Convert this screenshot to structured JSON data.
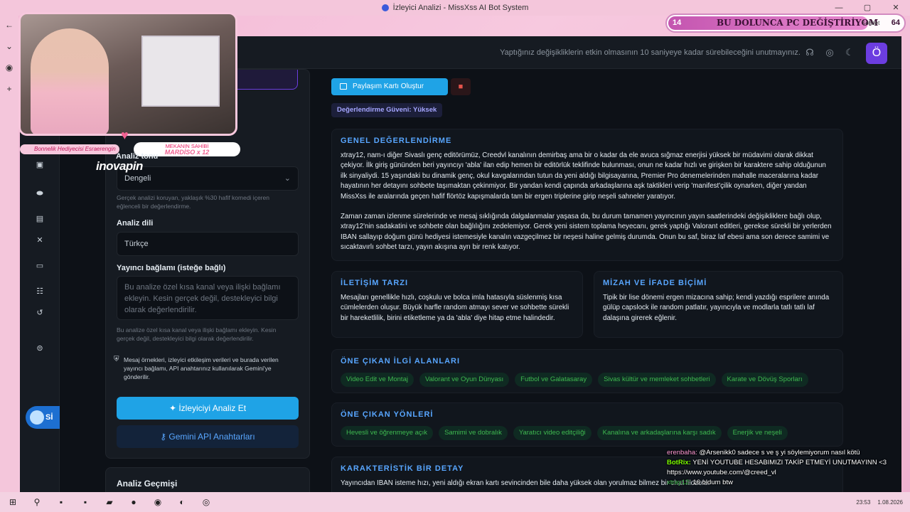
{
  "window": {
    "title": "İzleyici Analizi - MissXss AI Bot System"
  },
  "header": {
    "note": "Yaptığınız değişikliklerin etkin olmasının 10 saniyeye kadar sürebileceğini unutmayınız.",
    "avatar_letter": "Ö"
  },
  "stream_overlay": {
    "goal_current": "14",
    "goal_text": "BU DOLUNCA PC DEĞİŞTİRİYOM",
    "goal_sub": "Sohbet",
    "goal_target": "64",
    "caption_left": "Bonnelik Hediyecisi Esraerengin",
    "caption_right_title": "MEKANIN SAHİBİ",
    "caption_right_name": "MARDİSO x 12",
    "logo": "inovapin"
  },
  "left_panel": {
    "analysis_tone_label": "Analiz tonu",
    "tone_value": "Dengeli",
    "tone_help": "Gerçek analizi koruyan, yaklaşık %30 hafif komedi içeren eğlenceli bir değerlendirme.",
    "language_label": "Analiz dili",
    "language_value": "Türkçe",
    "context_label": "Yayıncı bağlamı (isteğe bağlı)",
    "context_placeholder": "Bu analize özel kısa kanal veya ilişki bağlamı ekleyin. Kesin gerçek değil, destekleyici bilgi olarak değerlendirilir.",
    "context_help": "Bu analize özel kısa kanal veya ilişki bağlamı ekleyin. Kesin gerçek değil, destekleyici bilgi olarak değerlendirilir.",
    "privacy_notice": "Mesaj örnekleri, izleyici etkileşim verileri ve burada verilen yayıncı bağlamı, API anahtarınız kullanılarak Gemini'ye gönderilir.",
    "analyze_button": "İzleyiciyi Analiz Et",
    "keys_button": "Gemini API Anahtarları",
    "history_title": "Analiz Geçmişi"
  },
  "sidebar": {
    "pill_label": "Sİ"
  },
  "content": {
    "share_button": "Paylaşım Kartı Oluştur",
    "confidence_badge": "Değerlendirme Güveni: Yüksek",
    "general": {
      "title": "GENEL DEĞERLENDİRME",
      "p1": "xtray12, nam-ı diğer Sivaslı genç editörümüz, Creedvl kanalının demirbaş ama bir o kadar da ele avuca sığmaz enerjisi yüksek bir müdavimi olarak dikkat çekiyor. İlk giriş gününden beri yayıncıyı 'abla' ilan edip hemen bir editörlük teklifinde bulunması, onun ne kadar hızlı ve girişken bir karaktere sahip olduğunun ilk sinyaliydi. 15 yaşındaki bu dinamik genç, okul kavgalarından tutun da yeni aldığı bilgisayarına, Premier Pro denemelerinden mahalle maceralarına kadar hayatının her detayını sohbete taşımaktan çekinmiyor. Bir yandan kendi çapında arkadaşlarına aşk taktikleri verip 'manifest'çilik oynarken, diğer yandan MissXss ile aralarında geçen hafif flörtöz kapışmalarda tam bir ergen triplerine girip neşeli sahneler yaratıyor.",
      "p2": "Zaman zaman izlenme sürelerinde ve mesaj sıklığında dalgalanmalar yaşasa da, bu durum tamamen yayıncının yayın saatlerindeki değişikliklere bağlı olup, xtray12'nin sadakatini ve sohbete olan bağlılığını zedelemiyor. Gerek yeni sistem toplama heyecanı, gerek yaptığı Valorant editleri, gerekse sürekli bir yerlerden IBAN sallayıp doğum günü hediyesi istemesiyle kanalın vazgeçilmez bir neşesi haline gelmiş durumda. Onun bu saf, biraz laf ebesi ama son derece samimi ve sıcaktavırlı sohbet tarzı, yayın akışına ayrı bir renk katıyor."
    },
    "communication": {
      "title": "İLETİŞİM TARZI",
      "text": "Mesajları genellikle hızlı, coşkulu ve bolca imla hatasıyla süslenmiş kısa cümlelerden oluşur. Büyük harfle random atmayı sever ve sohbette sürekli bir hareketlilik, birini etiketleme ya da 'abla' diye hitap etme halindedir."
    },
    "humor": {
      "title": "MİZAH VE İFADE BİÇİMİ",
      "text": "Tipik bir lise dönemi ergen mizacına sahip; kendi yazdığı esprilere anında gülüp capslock ile random patlatır, yayıncıyla ve modlarla tatlı tatlı laf dalaşına girerek eğlenir."
    },
    "interests": {
      "title": "ÖNE ÇIKAN İLGİ ALANLARI",
      "tags": [
        "Video Edit ve Montaj",
        "Valorant ve Oyun Dünyası",
        "Futbol ve Galatasaray",
        "Sivas kültür ve memleket sohbetleri",
        "Karate ve Dövüş Sporları"
      ]
    },
    "traits": {
      "title": "ÖNE ÇIKAN YÖNLERİ",
      "tags": [
        "Hevesli ve öğrenmeye açık",
        "Samimi ve dobralık",
        "Yaratıcı video editçiliği",
        "Kanalına ve arkadaşlarına karşı sadık",
        "Enerjik ve neşeli"
      ]
    },
    "detail": {
      "title": "KARAKTERİSTİK BİR DETAY",
      "text": "Yayıncıdan IBAN isteme hızı, yeni aldığı ekran kartı sevincinden bile daha yüksek olan yorulmaz bilmez bir chat filozofu."
    }
  },
  "chat": [
    {
      "user": "erenbaha:",
      "msg": "@Arsenikk0 sadece s ve ş yi söylemiyorum nasıl kötü"
    },
    {
      "user": "BotRix:",
      "msg": "YENİ YOUTUBE HESABIMIZI TAKİP ETMEYİ UNUTMAYINN <3"
    },
    {
      "user": "",
      "msg": "https://www.youtube.com/@creed_vl"
    },
    {
      "user": "xtray12:",
      "msg": "16 oldum btw"
    }
  ],
  "taskbar": {
    "time": "23:53",
    "date": "1.08.2026"
  },
  "colors": {
    "accent": "#1fa3e6",
    "title_blue": "#58a6ff",
    "tag_green": "#3fb950",
    "bg": "#0d1117"
  }
}
